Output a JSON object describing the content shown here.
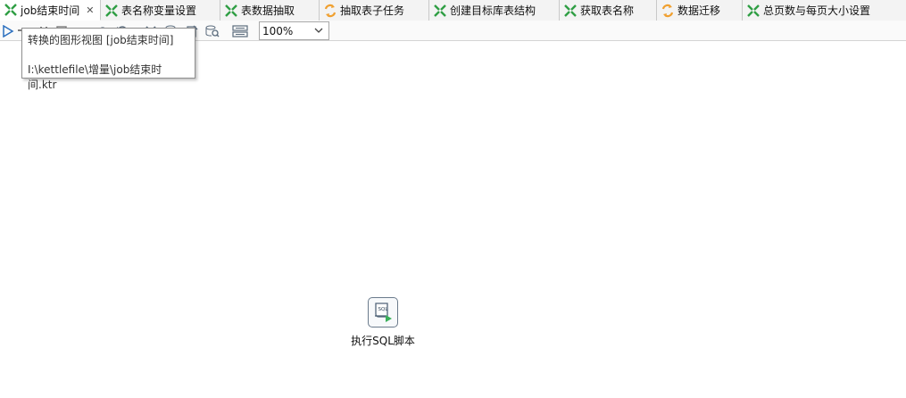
{
  "tabs": [
    {
      "label": "job结束时间",
      "icon": "job-icon",
      "active": true,
      "closable": true
    },
    {
      "label": "表名称变量设置",
      "icon": "job-icon"
    },
    {
      "label": "表数据抽取",
      "icon": "job-icon"
    },
    {
      "label": "抽取表子任务",
      "icon": "transformation-icon"
    },
    {
      "label": "创建目标库表结构",
      "icon": "job-icon"
    },
    {
      "label": "获取表名称",
      "icon": "job-icon"
    },
    {
      "label": "数据迁移",
      "icon": "transformation-icon"
    },
    {
      "label": "总页数与每页大小设置",
      "icon": "job-icon"
    }
  ],
  "toolbar": {
    "zoom_value": "100%",
    "icons": [
      "run-icon",
      "dropdown-icon",
      "pause-icon",
      "stop-icon",
      "preview-icon",
      "debug-icon",
      "replay-icon",
      "verify-icon",
      "analyze-icon",
      "sql-icon",
      "explore-db-icon",
      "show-results-icon"
    ]
  },
  "tooltip": {
    "line1": "转换的图形视图 [job结束时间]",
    "line2": "I:\\kettlefile\\增量\\job结束时间.ktr"
  },
  "canvas": {
    "step": {
      "label": "执行SQL脚本",
      "icon": "sql-script-icon",
      "icon_text": "SQL"
    }
  },
  "colors": {
    "job_icon_green": "#2f9e44",
    "transformation_icon_orange": "#f0a030"
  }
}
